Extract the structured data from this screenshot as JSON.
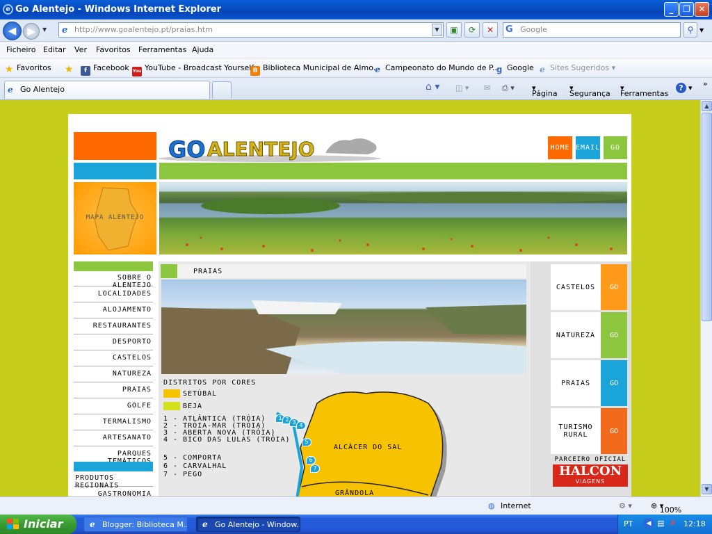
{
  "window": {
    "title": "Go Alentejo - Windows Internet Explorer",
    "min": "_",
    "max": "❐",
    "close": "✕"
  },
  "address": {
    "url": "http://www.goalentejo.pt/praias.htm",
    "search_placeholder": "Google",
    "go_icon": "search-icon"
  },
  "menu": [
    "Ficheiro",
    "Editar",
    "Ver",
    "Favoritos",
    "Ferramentas",
    "Ajuda"
  ],
  "favorites": {
    "label": "Favoritos",
    "items": [
      "Facebook",
      "YouTube - Broadcast Yourself",
      "Biblioteca Municipal de Almo...",
      "Campeonato do Mundo de P...",
      "Google",
      "Sites Sugeridos"
    ]
  },
  "tab": {
    "label": "Go Alentejo"
  },
  "commands": [
    "Página",
    "Segurança",
    "Ferramentas"
  ],
  "site": {
    "logo": "GO ALENTEJO",
    "top_buttons": {
      "home": "HOME",
      "email": "EMAIL",
      "go": "GO"
    },
    "map_label": "MAPA ALENTEJO",
    "left_menu": [
      "SOBRE O ALENTEJO",
      "LOCALIDADES",
      "ALOJAMENTO",
      "RESTAURANTES",
      "DESPORTO",
      "CASTELOS",
      "NATUREZA",
      "PRAIAS",
      "GOLFE",
      "TERMALISMO",
      "ARTESANATO",
      "PARQUES TEMÁTICOS"
    ],
    "left_menu_after": [
      "PRODUTOS REGIONAIS",
      "GASTRONOMIA"
    ],
    "section_title": "PRAIAS",
    "legend_title": "DISTRITOS POR CORES",
    "districts": [
      {
        "name": "SETÚBAL",
        "color": "#f7c300"
      },
      {
        "name": "BEJA",
        "color": "#d4e01a"
      }
    ],
    "beaches_group1": [
      "1 - ATLÂNTICA (TRÓIA)",
      "2 - TRÓIA-MAR (TRÓIA)",
      "3 - ABERTA NOVA (TRÓIA)",
      "4 - BICO DAS LULAS (TRÓIA)"
    ],
    "beaches_group2": [
      "5 - COMPORTA",
      "6 - CARVALHAL",
      "7 - PEGO"
    ],
    "map_places": [
      "ALCÁCER DO SAL",
      "GRÂNDOLA"
    ],
    "map_markers": [
      "1",
      "2",
      "3",
      "4",
      "5",
      "6",
      "7"
    ],
    "right_nav": [
      {
        "label": "CASTELOS",
        "go": "GO",
        "color": "#ff9a1a"
      },
      {
        "label": "NATUREZA",
        "go": "GO",
        "color": "#8cc63f"
      },
      {
        "label": "PRAIAS",
        "go": "GO",
        "color": "#1ba4d8"
      },
      {
        "label": "TURISMO RURAL",
        "go": "GO",
        "color": "#f26a1b"
      }
    ],
    "partner_title": "PARCEIRO OFICIAL",
    "partner_name": "HALCON",
    "partner_sub": "VIAGENS"
  },
  "status": {
    "zone": "Internet",
    "zoom": "100%"
  },
  "taskbar": {
    "start": "Iniciar",
    "tasks": [
      "Blogger: Biblioteca M...",
      "Go Alentejo - Window..."
    ],
    "lang": "PT",
    "time": "12:18"
  },
  "colors": {
    "page_bg": "#c6cd1a",
    "orange": "#ff6a00",
    "blue": "#1ba4d8",
    "green": "#8cc63f"
  }
}
